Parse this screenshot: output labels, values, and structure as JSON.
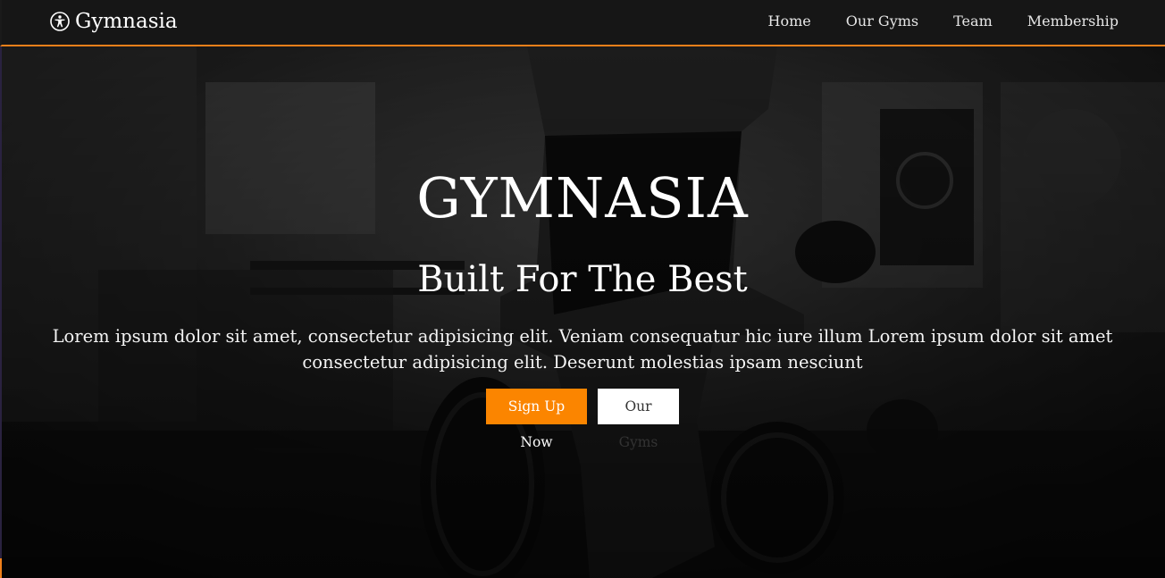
{
  "navbar": {
    "brand": "Gymnasia",
    "brand_icon": "universal-access-icon",
    "links": [
      {
        "label": "Home"
      },
      {
        "label": "Our Gyms"
      },
      {
        "label": "Team"
      },
      {
        "label": "Membership"
      }
    ],
    "accent_color": "#f0801a"
  },
  "hero": {
    "title": "GYMNASIA",
    "subtitle": "Built For The Best",
    "text": "Lorem ipsum dolor sit amet, consectetur adipisicing elit. Veniam consequatur hic iure illum Lorem ipsum dolor sit amet consectetur adipisicing elit. Deserunt molestias ipsam nesciunt",
    "primary_button": "Sign Up Now",
    "secondary_button": "Our Gyms",
    "primary_color": "#fb8500"
  }
}
